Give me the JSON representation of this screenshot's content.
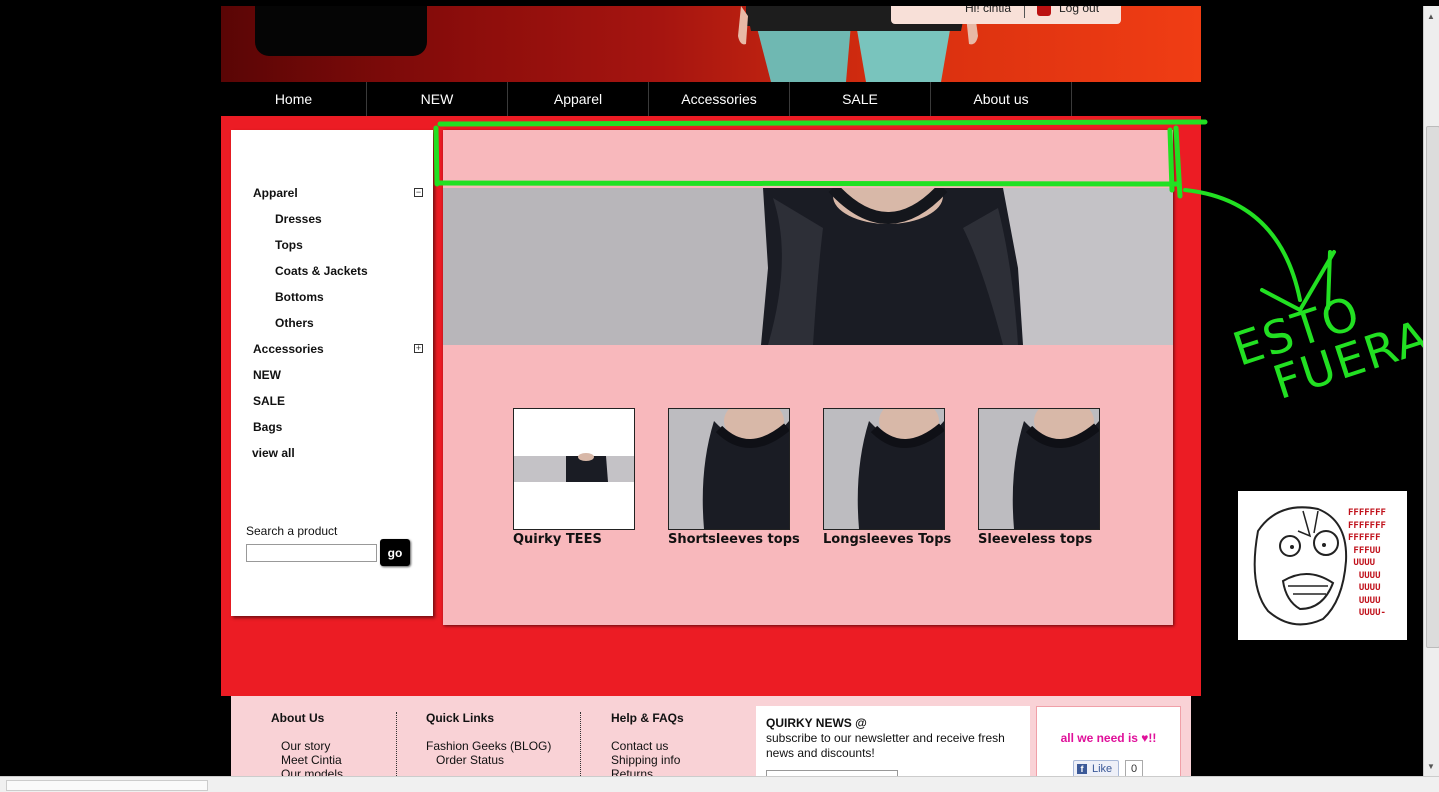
{
  "header": {
    "greeting": "Hi! cintia",
    "logout_label": "Log out"
  },
  "nav": {
    "items": [
      "Home",
      "NEW",
      "Apparel",
      "Accessories",
      "SALE",
      "About us"
    ]
  },
  "sidebar": {
    "categories": [
      {
        "label": "Apparel",
        "toggle": "−"
      },
      {
        "label": "Accessories",
        "toggle": "+"
      },
      {
        "label": "NEW"
      },
      {
        "label": "SALE"
      },
      {
        "label": "Bags"
      },
      {
        "label": "view all"
      }
    ],
    "apparel_subcategories": [
      "Dresses",
      "Tops",
      "Coats & Jackets",
      "Bottoms",
      "Others"
    ],
    "search_label": "Search a product",
    "search_value": "",
    "go_label": "go"
  },
  "products": [
    {
      "label": "Quirky TEES"
    },
    {
      "label": "Shortsleeves tops"
    },
    {
      "label": "Longsleeves Tops"
    },
    {
      "label": "Sleeveless tops"
    }
  ],
  "footer": {
    "about": {
      "heading": "About Us",
      "links": [
        "Our story",
        "Meet Cintia",
        "Our models"
      ]
    },
    "quick": {
      "heading": "Quick Links",
      "links": [
        "Fashion Geeks (BLOG)",
        "Order Status"
      ]
    },
    "help": {
      "heading": "Help & FAQs",
      "links": [
        "Contact us",
        "Shipping info",
        "Returns"
      ]
    },
    "news": {
      "heading": "QUIRKY NEWS @",
      "text": "subscribe to our newsletter and receive fresh news and discounts!"
    },
    "love": {
      "text": "all we need is ♥!!",
      "like_label": "Like",
      "like_count": "0"
    }
  },
  "annotation": {
    "line1": "ESTO",
    "line2": "FUERA",
    "rage_text": "FFFFFFF\nFFFFFFF\nFFFFFF\n FFFUU\n UUUU\n  UUUU\n  UUUU\n  UUUU\n  UUUU-"
  },
  "colors": {
    "page_bg": "#000000",
    "red_area": "#ec1c24",
    "pink_panel": "#f8b8bc",
    "footer_pink": "#f9d2d6",
    "annotation_green": "#22e022",
    "love_magenta": "#e0109a"
  }
}
